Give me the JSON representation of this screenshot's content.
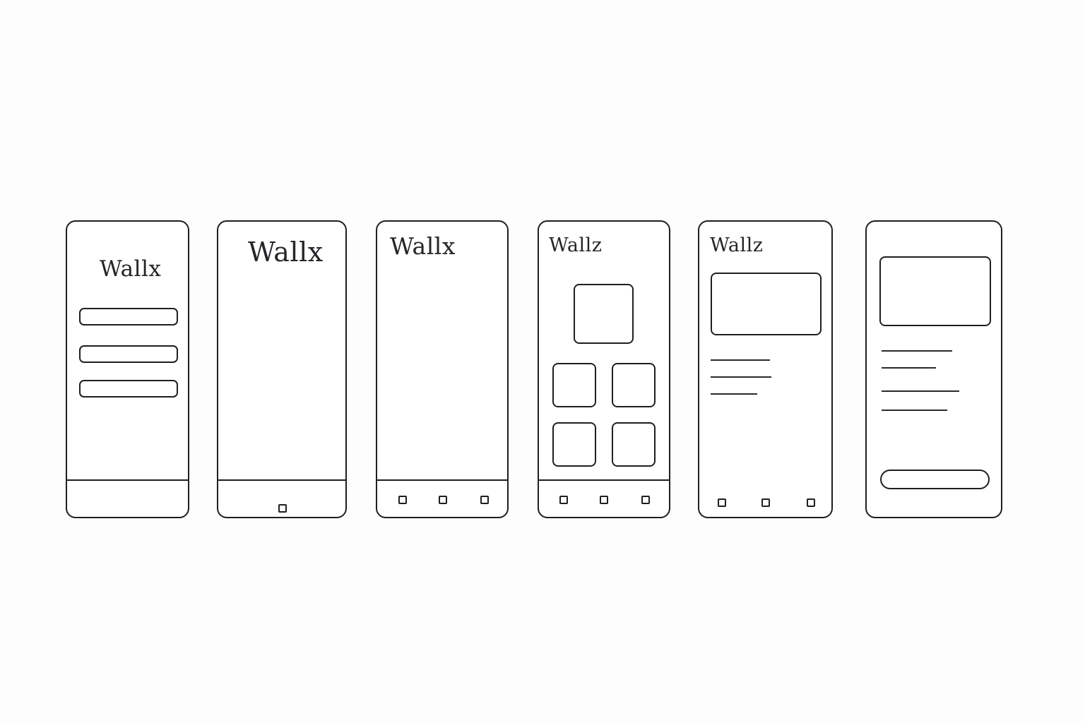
{
  "screens": [
    {
      "id": "login",
      "title": "Wallx"
    },
    {
      "id": "splash",
      "title": "Wallx"
    },
    {
      "id": "home-empty",
      "title": "Wallx"
    },
    {
      "id": "grid",
      "title": "Wallz"
    },
    {
      "id": "detail",
      "title": "Wallz"
    },
    {
      "id": "preview",
      "title": ""
    }
  ],
  "colors": {
    "stroke": "#1f1f22",
    "text": "#26262a",
    "background": "#fdfdfd"
  }
}
